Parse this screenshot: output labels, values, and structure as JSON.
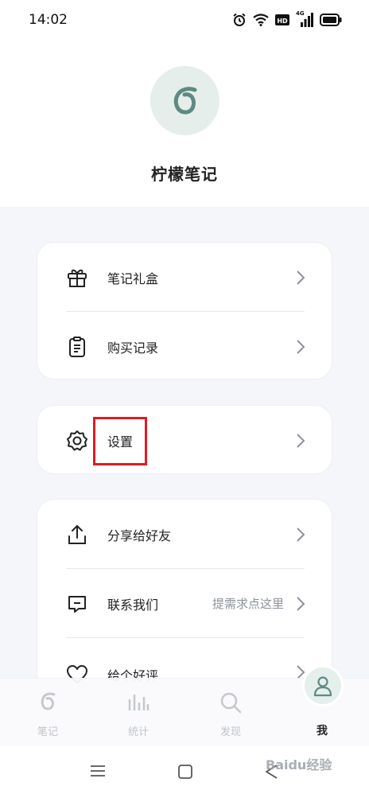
{
  "status_bar": {
    "time": "14:02",
    "network": "4G"
  },
  "profile": {
    "app_name": "柠檬笔记"
  },
  "menu": {
    "gift_box": "笔记礼盒",
    "purchase_history": "购买记录",
    "settings": "设置",
    "share": "分享给好友",
    "contact": "联系我们",
    "contact_hint": "提需求点这里",
    "rate": "给个好评"
  },
  "tabs": [
    {
      "label": "笔记",
      "icon": "notes-logo-icon"
    },
    {
      "label": "统计",
      "icon": "stats-bars-icon"
    },
    {
      "label": "发现",
      "icon": "search-icon"
    },
    {
      "label": "我",
      "icon": "person-icon",
      "active": true
    }
  ],
  "watermark": "Baidu经验",
  "colors": {
    "accent": "#5e8a82",
    "highlight": "#e11b22",
    "background": "#f5f6fa"
  }
}
